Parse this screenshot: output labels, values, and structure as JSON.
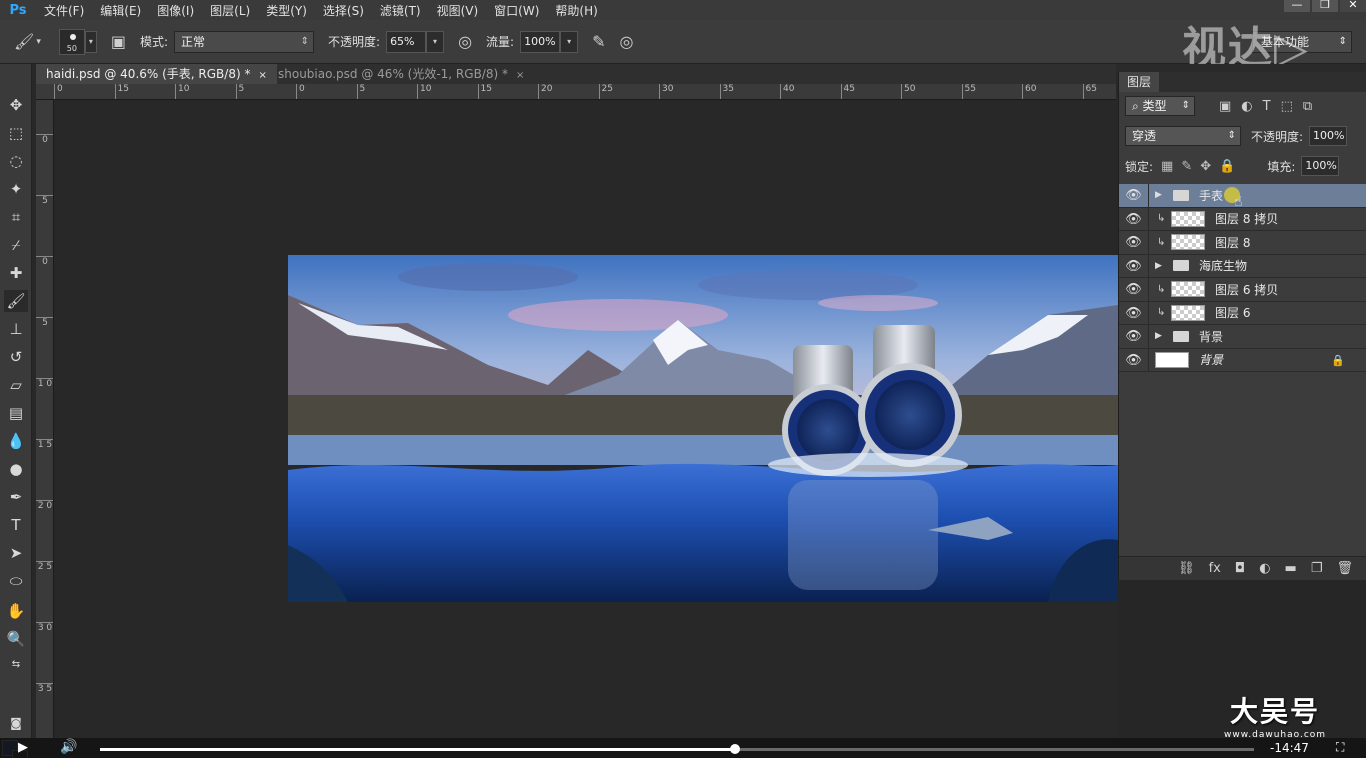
{
  "app": {
    "logo": "Ps",
    "menu": [
      "文件(F)",
      "编辑(E)",
      "图像(I)",
      "图层(L)",
      "类型(Y)",
      "选择(S)",
      "滤镜(T)",
      "视图(V)",
      "窗口(W)",
      "帮助(H)"
    ],
    "window_controls": [
      "—",
      "❐",
      "✕"
    ]
  },
  "options": {
    "brush_size": "50",
    "mode_label": "模式:",
    "mode_value": "正常",
    "opacity_label": "不透明度:",
    "opacity_value": "65%",
    "flow_label": "流量:",
    "flow_value": "100%",
    "workspace": "基本功能"
  },
  "watermarks": {
    "top": "视达▷",
    "bottom_big": "大吴号",
    "bottom_small": "www.dawuhao.com"
  },
  "tabs": [
    {
      "label": "haidi.psd @ 40.6% (手表, RGB/8) *",
      "close": "×"
    },
    {
      "label": "shoubiao.psd @ 46% (光效-1, RGB/8) *",
      "close": "×"
    }
  ],
  "ruler_top": [
    "0",
    "15",
    "10",
    "5",
    "0",
    "5",
    "10",
    "15",
    "20",
    "25",
    "30",
    "35",
    "40",
    "45",
    "50",
    "55",
    "60",
    "65"
  ],
  "ruler_left": [
    "0",
    "5",
    "0",
    "5",
    "1 0",
    "1 5",
    "2 0",
    "2 5",
    "3 0",
    "3 5"
  ],
  "layers_panel": {
    "tab": "图层",
    "filter_kind": "类型",
    "blend_mode": "穿透",
    "opacity_label": "不透明度:",
    "opacity_value": "100%",
    "lock_label": "锁定:",
    "fill_label": "填充:",
    "fill_value": "100%",
    "layers": [
      {
        "name": "手表",
        "type": "group",
        "selected": true
      },
      {
        "name": "图层 8 拷贝",
        "type": "clipped"
      },
      {
        "name": "图层 8",
        "type": "clipped"
      },
      {
        "name": "海底生物",
        "type": "group"
      },
      {
        "name": "图层 6 拷贝",
        "type": "clipped"
      },
      {
        "name": "图层 6",
        "type": "clipped"
      },
      {
        "name": "背景",
        "type": "group"
      },
      {
        "name": "背景",
        "type": "background",
        "locked": true
      }
    ]
  },
  "video": {
    "progress": 0.55,
    "time_remaining": "-14:47"
  }
}
